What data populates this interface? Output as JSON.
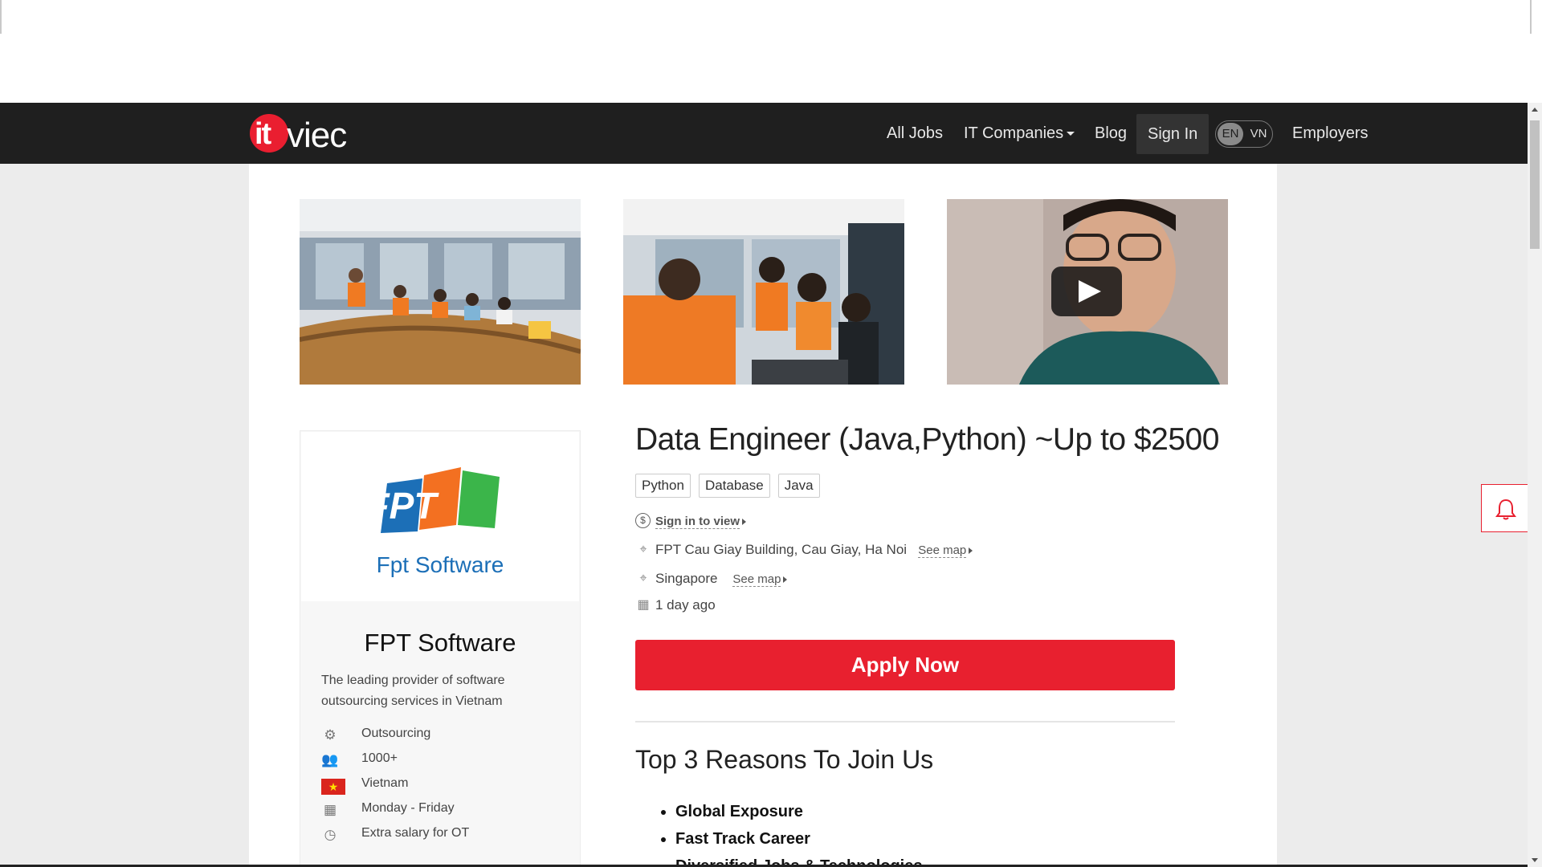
{
  "brand": {
    "logo_it": "it",
    "logo_viec": "viec"
  },
  "nav": {
    "all_jobs": "All Jobs",
    "it_companies": "IT Companies",
    "blog": "Blog",
    "sign_in": "Sign In",
    "lang_en": "EN",
    "lang_vn": "VN",
    "employers": "Employers"
  },
  "gallery": [
    {
      "alt": "office-meeting-photo"
    },
    {
      "alt": "team-high-five-photo"
    },
    {
      "alt": "employee-video-thumbnail",
      "video": true
    }
  ],
  "company": {
    "logo_text": "FPT",
    "logo_subtitle": "Fpt Software",
    "name": "FPT Software",
    "description": "The leading provider of software outsourcing services in Vietnam",
    "type": "Outsourcing",
    "size": "1000+",
    "country": "Vietnam",
    "working_days": "Monday - Friday",
    "overtime": "Extra salary for OT"
  },
  "job": {
    "title": "Data Engineer (Java,Python) ~Up to $2500",
    "tags": [
      "Python",
      "Database",
      "Java"
    ],
    "salary_link": "Sign in to view",
    "address_1": "FPT Cau Giay Building, Cau Giay, Ha Noi",
    "address_2": "Singapore",
    "see_map": "See map",
    "posted": "1 day ago",
    "apply_label": "Apply Now"
  },
  "reasons": {
    "title": "Top 3 Reasons To Join Us",
    "items": [
      "Global Exposure",
      "Fast Track Career",
      "Diversified Jobs & Technologies"
    ]
  },
  "colors": {
    "brand_red": "#e8202f",
    "navbar": "#1f1f1f",
    "fpt_blue": "#1c6fb7",
    "fpt_orange": "#f37021",
    "fpt_green": "#3bb54a"
  }
}
